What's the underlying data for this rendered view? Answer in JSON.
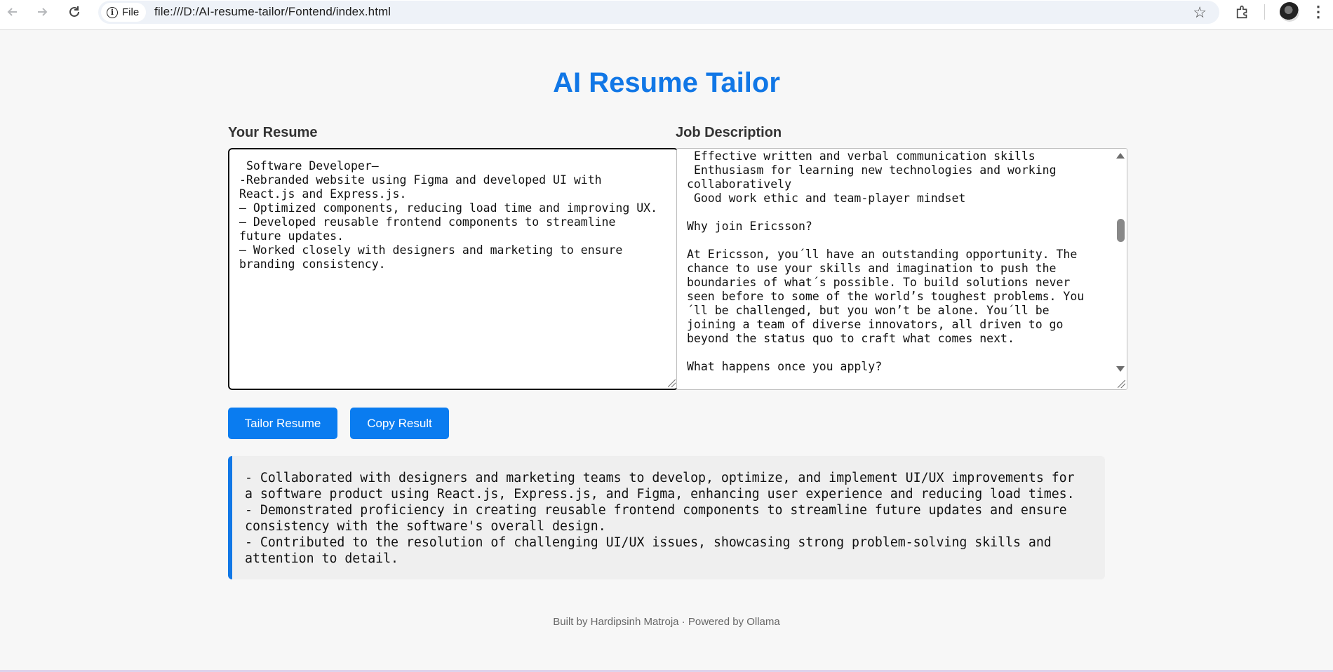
{
  "browser": {
    "site_info_label": "File",
    "url": "file:///D:/AI-resume-tailor/Fontend/index.html"
  },
  "page": {
    "title": "AI Resume Tailor",
    "resume_label": "Your Resume",
    "job_label": "Job Description",
    "resume_text": " Software Developer–\n-Rebranded website using Figma and developed UI with React.js and Express.js.\n– Optimized components, reducing load time and improving UX.\n– Developed reusable frontend components to streamline future updates.\n– Worked closely with designers and marketing to ensure branding consistency.",
    "job_text": " Effective written and verbal communication skills\n Enthusiasm for learning new technologies and working collaboratively\n Good work ethic and team-player mindset\n\nWhy join Ericsson?\n\nAt Ericsson, you´ll have an outstanding opportunity. The chance to use your skills and imagination to push the boundaries of what´s possible. To build solutions never seen before to some of the world’s toughest problems. You´ll be challenged, but you won’t be alone. You´ll be joining a team of diverse innovators, all driven to go beyond the status quo to craft what comes next.\n\nWhat happens once you apply?",
    "tailor_button": "Tailor Resume",
    "copy_button": "Copy Result",
    "result_text": "- Collaborated with designers and marketing teams to develop, optimize, and implement UI/UX improvements for\na software product using React.js, Express.js, and Figma, enhancing user experience and reducing load times.\n- Demonstrated proficiency in creating reusable frontend components to streamline future updates and ensure\nconsistency with the software's overall design.\n- Contributed to the resolution of challenging UI/UX issues, showcasing strong problem-solving skills and\nattention to detail.",
    "footer": "Built by Hardipsinh Matroja · Powered by Ollama"
  },
  "colors": {
    "accent": "#1177e6",
    "button": "#0a7cf0",
    "result_bg": "#efefef",
    "page_bg": "#f7f7f7"
  }
}
